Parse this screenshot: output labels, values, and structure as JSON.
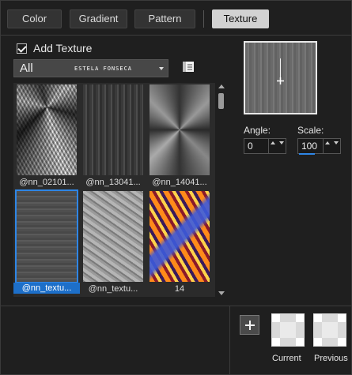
{
  "tabs": [
    {
      "label": "Color",
      "active": false
    },
    {
      "label": "Gradient",
      "active": false
    },
    {
      "label": "Pattern",
      "active": false
    },
    {
      "label": "Texture",
      "active": true
    }
  ],
  "add_texture": {
    "label": "Add Texture",
    "checked": true
  },
  "category": {
    "selected": "All",
    "signature": "ESTELA FONSECA"
  },
  "thumbnails": [
    {
      "caption": "@nn_02101...",
      "selected": false
    },
    {
      "caption": "@nn_13041...",
      "selected": false
    },
    {
      "caption": "@nn_14041...",
      "selected": false
    },
    {
      "caption": "@nn_textu...",
      "selected": true
    },
    {
      "caption": "@nn_textu...",
      "selected": false
    },
    {
      "caption": "14",
      "selected": false
    }
  ],
  "angle": {
    "label": "Angle:",
    "value": "0"
  },
  "scale": {
    "label": "Scale:",
    "value": "100"
  },
  "swatches": {
    "current_label": "Current",
    "previous_label": "Previous"
  },
  "colors": {
    "selection_accent": "#1d6fc9",
    "active_tab": "#d2d2d2"
  },
  "icons": [
    "checkmark-icon",
    "chevron-down-icon",
    "texture-library-icon",
    "scroll-up-icon",
    "scroll-down-icon",
    "crosshair-icon",
    "plus-icon"
  ]
}
